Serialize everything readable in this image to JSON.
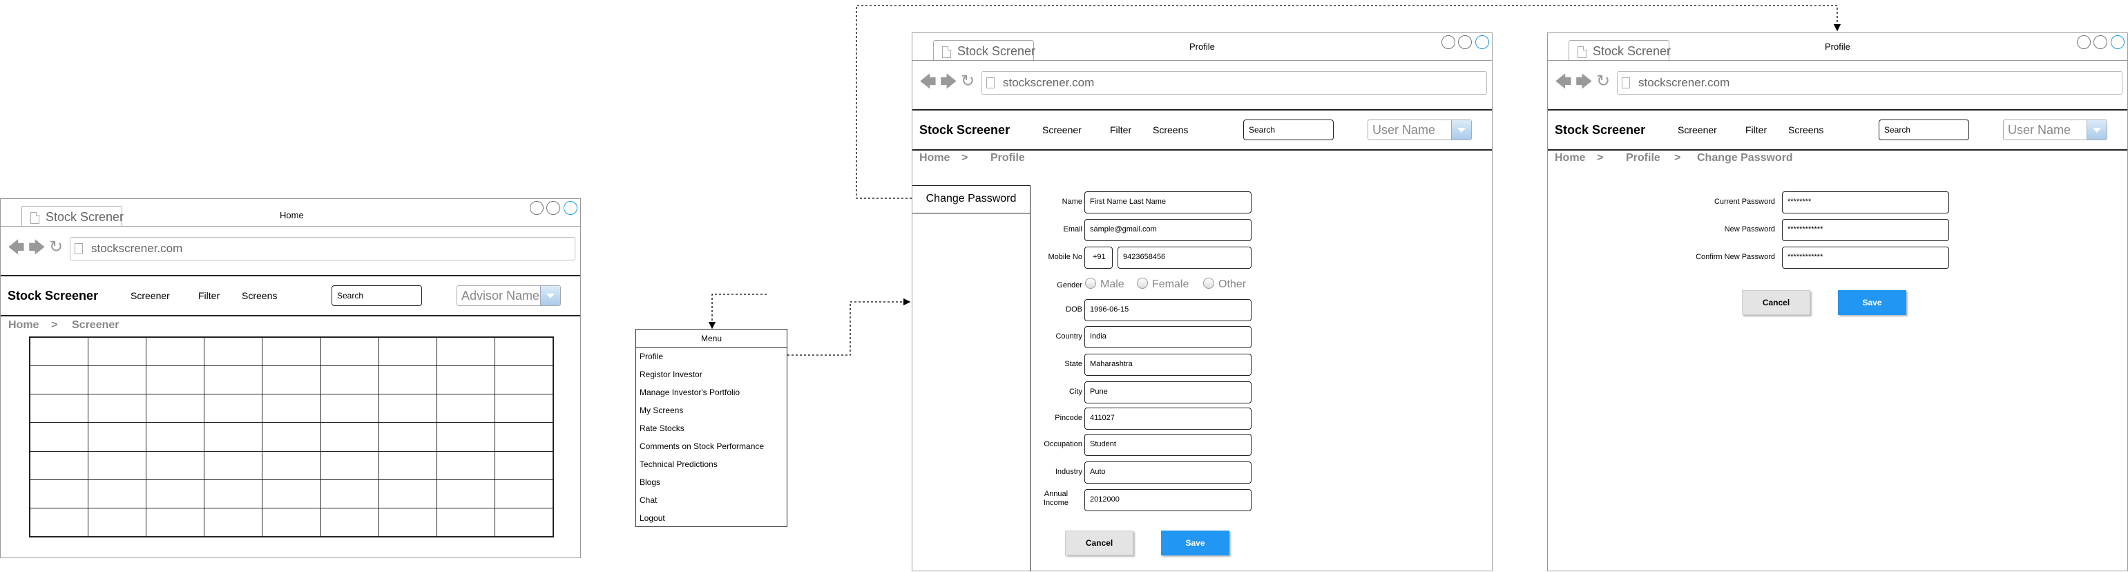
{
  "home": {
    "tab_title": "Stock Screner",
    "window_title": "Home",
    "url": "stockscrener.com",
    "brand": "Stock Screener",
    "nav": [
      "Screener",
      "Filter",
      "Screens"
    ],
    "search_placeholder": "Search",
    "user_combo": "Advisor Name",
    "breadcrumb": [
      "Home",
      ">",
      "Screener"
    ],
    "grid": {
      "rows": 7,
      "cols": 9
    }
  },
  "menu": {
    "title": "Menu",
    "items": [
      "Profile",
      "Registor Investor",
      "Manage Investor's Portfolio",
      "My Screens",
      "Rate Stocks",
      "Comments on Stock Performance",
      "Technical Predictions",
      "Blogs",
      "Chat",
      "Logout"
    ]
  },
  "profile": {
    "tab_title": "Stock Screner",
    "window_title": "Profile",
    "url": "stockscrener.com",
    "brand": "Stock Screener",
    "nav": [
      "Screener",
      "Filter",
      "Screens"
    ],
    "search_placeholder": "Search",
    "user_combo": "User Name",
    "breadcrumb": [
      "Home",
      ">",
      "Profile"
    ],
    "sidebar_link": "Change Password",
    "fields": [
      {
        "label": "Name",
        "value": "First Name Last Name"
      },
      {
        "label": "Email",
        "value": "sample@gmail.com"
      },
      {
        "label": "Mobile No",
        "code": "+91",
        "value": "9423658456"
      },
      {
        "label": "Gender",
        "options": [
          "Male",
          "Female",
          "Other"
        ]
      },
      {
        "label": "DOB",
        "value": "1996-06-15"
      },
      {
        "label": "Country",
        "value": "India"
      },
      {
        "label": "State",
        "value": "Maharashtra"
      },
      {
        "label": "City",
        "value": "Pune"
      },
      {
        "label": "Pincode",
        "value": "411027"
      },
      {
        "label": "Occupation",
        "value": "Student"
      },
      {
        "label": "Industry",
        "value": "Auto"
      },
      {
        "label": "Annual\nIncome",
        "value": "2012000"
      }
    ],
    "cancel": "Cancel",
    "save": "Save"
  },
  "password": {
    "tab_title": "Stock Screner",
    "window_title": "Profile",
    "url": "stockscrener.com",
    "brand": "Stock Screener",
    "nav": [
      "Screener",
      "Filter",
      "Screens"
    ],
    "search_placeholder": "Search",
    "user_combo": "User Name",
    "breadcrumb": [
      "Home",
      ">",
      "Profile",
      ">",
      "Change Password"
    ],
    "fields": [
      {
        "label": "Current Password",
        "value": "********"
      },
      {
        "label": "New Password",
        "value": "************"
      },
      {
        "label": "Confirm New Password",
        "value": "************"
      }
    ],
    "cancel": "Cancel",
    "save": "Save"
  },
  "colors": {
    "accent": "#2196f3",
    "window_control_active": "#1e9be0",
    "combo_button": "#a9cbea"
  }
}
